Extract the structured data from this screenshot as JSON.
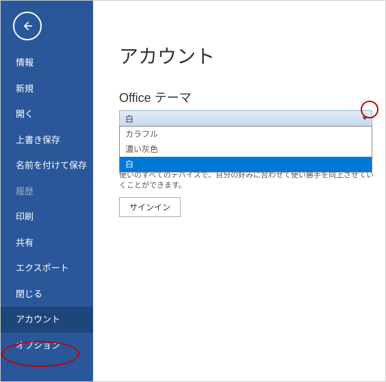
{
  "sidebar": {
    "items": [
      {
        "label": "情報",
        "name": "sidebar-item-info",
        "active": false,
        "disabled": false
      },
      {
        "label": "新規",
        "name": "sidebar-item-new",
        "active": false,
        "disabled": false
      },
      {
        "label": "開く",
        "name": "sidebar-item-open",
        "active": false,
        "disabled": false
      },
      {
        "label": "上書き保存",
        "name": "sidebar-item-save",
        "active": false,
        "disabled": false
      },
      {
        "label": "名前を付けて保存",
        "name": "sidebar-item-save-as",
        "active": false,
        "disabled": false
      },
      {
        "label": "履歴",
        "name": "sidebar-item-history",
        "active": false,
        "disabled": true
      },
      {
        "label": "印刷",
        "name": "sidebar-item-print",
        "active": false,
        "disabled": false
      },
      {
        "label": "共有",
        "name": "sidebar-item-share",
        "active": false,
        "disabled": false
      },
      {
        "label": "エクスポート",
        "name": "sidebar-item-export",
        "active": false,
        "disabled": false
      },
      {
        "label": "閉じる",
        "name": "sidebar-item-close",
        "active": false,
        "disabled": false
      },
      {
        "label": "アカウント",
        "name": "sidebar-item-account",
        "active": true,
        "disabled": false
      },
      {
        "label": "オプション",
        "name": "sidebar-item-options",
        "active": false,
        "disabled": false
      }
    ]
  },
  "main": {
    "title": "アカウント",
    "theme_label": "Office テーマ",
    "theme_selected": "白",
    "theme_options": [
      {
        "label": "カラフル",
        "selected": false
      },
      {
        "label": "濃い灰色",
        "selected": false
      },
      {
        "label": "白",
        "selected": true
      }
    ],
    "description": "使いのすべてのデバイスで、自分の好みに合わせて使い勝手を向上させていくことができます。",
    "signin_label": "サインイン"
  }
}
